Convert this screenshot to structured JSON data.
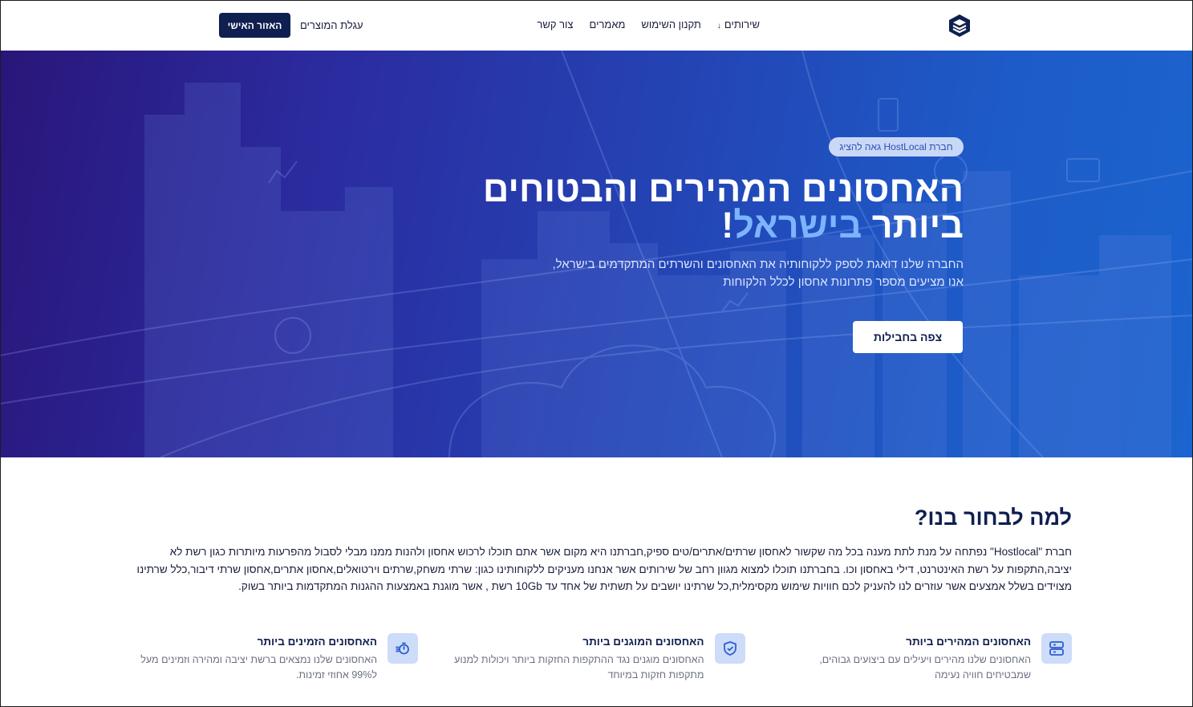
{
  "nav": {
    "logo_icon": "stacked-layers-logo-icon",
    "links": [
      "שירותים",
      "תקנון השימוש",
      "מאמרים",
      "צור קשר"
    ],
    "services_chevron_icon": "chevron-down-icon",
    "cart_label": "עגלת המוצרים",
    "account_label": "האזור האישי"
  },
  "hero": {
    "badge": "חברת HostLocal גאה להציג",
    "title_line1": "האחסונים המהירים והבטוחים",
    "title_line2_part1": "ביותר ",
    "title_line2_highlight": "בישראל",
    "title_line2_part2": "!",
    "subtitle_line1": "החברה שלנו דואגת לספק ללקוחותיה את האחסונים והשרתים המתקדמים בישראל,",
    "subtitle_line2": "אנו מציעים מספר פתרונות אחסון לכלל הלקוחות",
    "cta_label": "צפה בחבילות",
    "highlight_color": "#7db4ff"
  },
  "why": {
    "title": "למה לבחור בנו?",
    "text": "חברת \"Hostlocal\" נפתחה על מנת לתת מענה בכל מה שקשור לאחסון שרתים/אתרים/טים ספיק,חברתנו היא מקום אשר אתם תוכלו לרכוש אחסון ולהנות ממנו מבלי לסבול מהפרעות מיותרות כגון רשת לא יציבה,התקפות על רשת האינטרנט, דילי באחסון וכו. בחברתנו תוכלו למצוא מגוון רחב של שירותים אשר אנחנו מעניקים ללקוחותינו כגון: שרתי משחק,שרתים וירטואלים,אחסון אתרים,אחסון שרתי דיבור,כלל שרתינו מצוידים בשלל אמצעים אשר עוזרים לנו להעניק לכם חוויות שימוש מקסימלית,כל שרתינו יושבים על תשתית של אחד עד 10Gb רשת , אשר מוגנת באמצעות ההגנות המתקדמות ביותר בשוק."
  },
  "features": [
    {
      "icon": "server-icon",
      "title": "האחסונים המהירים ביותר",
      "desc": "האחסונים שלנו מהירים ויעילים עם ביצועים גבוהים, שמבטיחים חוויה נעימה"
    },
    {
      "icon": "shield-check-icon",
      "title": "האחסונים המוגנים ביותר",
      "desc": "האחסונים מוגנים נגד ההתקפות החזקות ביותר ויכולות למנוע מתקפות חזקות במיוחד"
    },
    {
      "icon": "stopwatch-icon",
      "title": "האחסונים הזמינים ביותר",
      "desc": "האחסונים שלנו נמצאים ברשת יציבה ומהירה וזמינים מעל ל99% אחוזי זמינות."
    }
  ],
  "colors": {
    "navy": "#0f1f4f",
    "accent_light": "#cddcf8",
    "accent": "#2c5fd0"
  }
}
